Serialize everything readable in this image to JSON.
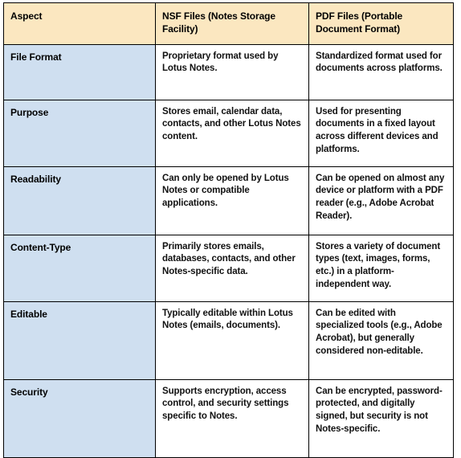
{
  "table": {
    "columns": [
      "Aspect",
      "NSF Files (Notes Storage Facility)",
      "PDF Files (Portable Document Format)"
    ],
    "rows": [
      {
        "aspect": "File Format",
        "nsf": "Proprietary format used by Lotus Notes.",
        "pdf": "Standardized format used for documents across platforms."
      },
      {
        "aspect": "Purpose",
        "nsf": "Stores email, calendar data, contacts, and other Lotus Notes content.",
        "pdf": "Used for presenting documents in a fixed layout across different devices and platforms."
      },
      {
        "aspect": "Readability",
        "nsf": "Can only be opened by Lotus Notes or compatible applications.",
        "pdf": "Can be opened on almost any device or platform with a PDF reader (e.g., Adobe Acrobat Reader)."
      },
      {
        "aspect": "Content-Type",
        "nsf": "Primarily stores emails, databases, contacts, and other Notes-specific data.",
        "pdf": "Stores a variety of document types (text, images, forms, etc.) in a platform-independent way."
      },
      {
        "aspect": "Editable",
        "nsf": "Typically editable within Lotus Notes (emails, documents).",
        "pdf": "Can be edited with specialized tools (e.g., Adobe Acrobat), but generally considered non-editable."
      },
      {
        "aspect": "Security",
        "nsf": "Supports encryption, access control, and security settings specific to Notes.",
        "pdf": "Can be encrypted, password-protected, and digitally signed, but security is not Notes-specific."
      }
    ]
  },
  "colors": {
    "header_background": "#fbe7c0",
    "aspect_column_background": "#cfdff0",
    "cell_background": "#ffffff",
    "border": "#000000",
    "text": "#000000"
  }
}
